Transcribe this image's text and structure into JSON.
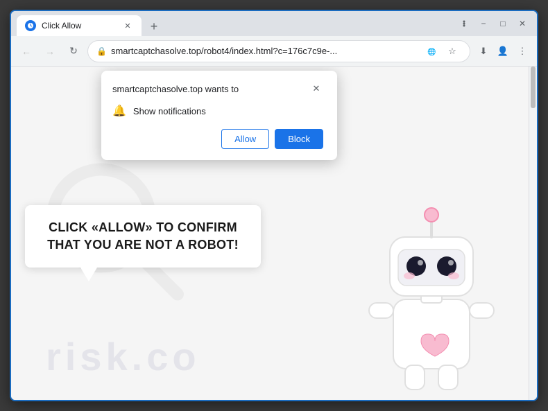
{
  "browser": {
    "tab": {
      "title": "Click Allow",
      "favicon_color": "#1a73e8"
    },
    "window_controls": {
      "minimize": "−",
      "maximize": "□",
      "close": "✕"
    },
    "address_bar": {
      "url": "smartcaptchasolve.top/robot4/index.html?c=176c7c9e-...",
      "lock_icon": "🔒"
    },
    "nav": {
      "back": "←",
      "forward": "→",
      "refresh": "↻"
    }
  },
  "notification_popup": {
    "title": "smartcaptchasolve.top wants to",
    "notification_item": "Show notifications",
    "allow_label": "Allow",
    "block_label": "Block",
    "close_label": "✕"
  },
  "page": {
    "message": "CLICK «ALLOW» TO CONFIRM THAT YOU ARE NOT A ROBOT!",
    "watermark": "risk.co"
  }
}
